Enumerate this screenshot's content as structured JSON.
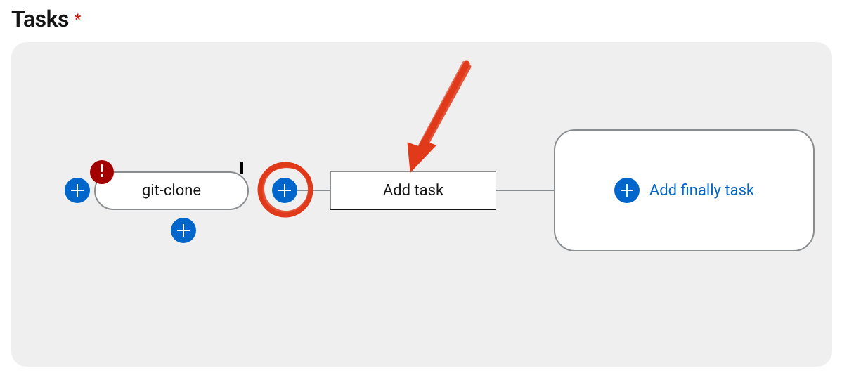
{
  "section": {
    "title": "Tasks",
    "required_marker": "*"
  },
  "pipeline": {
    "task_name": "git-clone",
    "add_task_label": "Add task",
    "finally_label": "Add finally task"
  }
}
